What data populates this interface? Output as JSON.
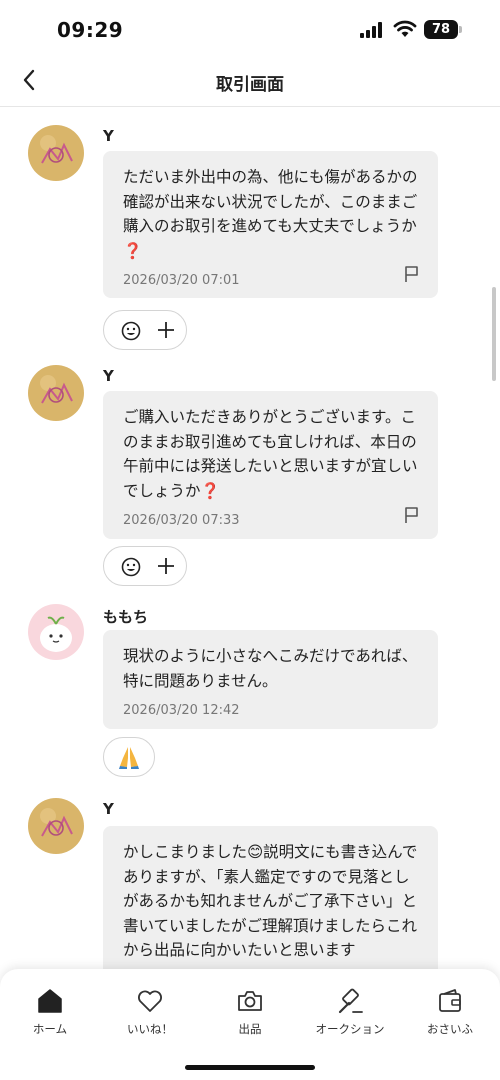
{
  "status": {
    "time": "09:29",
    "battery": "78"
  },
  "header": {
    "title": "取引画面"
  },
  "messages": [
    {
      "sender": "Y",
      "text": "ただいま外出中の為、他にも傷があるかの確認が出来ない状況でしたが、このままご購入のお取引を進めても大丈夫でしょうか",
      "suffix": "❓",
      "timestamp": "2026/03/20 07:01",
      "reaction": "add"
    },
    {
      "sender": "Y",
      "text": "ご購入いただきありがとうございます。このままお取引進めても宜しければ、本日の午前中には発送したいと思いますが宜しいでしょうか",
      "suffix": "❓",
      "timestamp": "2026/03/20 07:33",
      "reaction": "add"
    },
    {
      "sender": "ももち",
      "text": "現状のように小さなへこみだけであれば、特に問題ありません。",
      "suffix": "",
      "timestamp": "2026/03/20 12:42",
      "reaction": "🙏"
    },
    {
      "sender": "Y",
      "text": "かしこまりました😊説明文にも書き込んでありますが、「素人鑑定ですので見落としがあるかも知れませんがご了承下さい」と書いていましたがご理解頂けましたらこれから出品に向かいたいと思います",
      "suffix": "",
      "timestamp": "",
      "reaction": ""
    }
  ],
  "nav": {
    "items": [
      {
        "label": "ホーム",
        "icon": "home-icon",
        "active": true
      },
      {
        "label": "いいね！",
        "icon": "heart-icon",
        "active": false
      },
      {
        "label": "出品",
        "icon": "camera-icon",
        "active": false
      },
      {
        "label": "オークション",
        "icon": "gavel-icon",
        "active": false
      },
      {
        "label": "おさいふ",
        "icon": "wallet-icon",
        "active": false
      }
    ]
  },
  "colors": {
    "accent": "#d4141e",
    "bubble": "#efefef"
  }
}
